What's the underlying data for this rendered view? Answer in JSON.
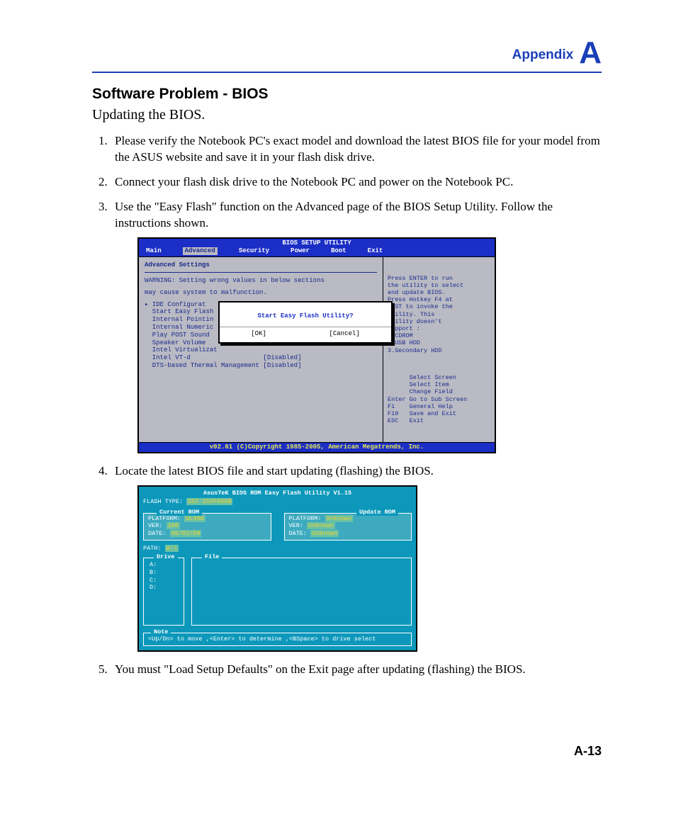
{
  "header": {
    "appendix": "Appendix",
    "letter": "A"
  },
  "title": "Software Problem - BIOS",
  "subtitle": "Updating the BIOS.",
  "steps": {
    "s1": "Please verify the Notebook PC's exact model and download the latest BIOS file for your model from the ASUS website and save it in your flash disk drive.",
    "s2": "Connect your flash disk drive to the Notebook PC and power on the Notebook PC.",
    "s3": "Use the \"Easy Flash\" function on the Advanced page of the BIOS Setup Utility. Follow the instructions shown.",
    "s4": "Locate the latest BIOS file and start updating (flashing) the BIOS.",
    "s5": "You must \"Load Setup Defaults\" on the Exit page after updating (flashing) the BIOS."
  },
  "bios": {
    "title": "BIOS SETUP UTILITY",
    "menu": {
      "main": "Main",
      "advanced": "Advanced",
      "security": "Security",
      "power": "Power",
      "boot": "Boot",
      "exit": "Exit"
    },
    "section": "Advanced Settings",
    "warning1": "WARNING: Setting wrong values in below sections",
    "warning2": "         may cause system to malfunction.",
    "items_text": "▸ IDE Configurat\n  Start Easy Flash\n  Internal Pointin\n  Internal Numeric\n  Play POST Sound\n  Speaker Volume\n  Intel Virtualizat\n  Intel VT-d                   [Disabled]\n  DTS-based Thermal Management [Disabled]",
    "help": "Press ENTER to run\nthe utility to select\nand update BIOS.\nPress Hotkey F4 at\nPOST to invoke the\nutility. This\nutility doesn't\nsupport :\n1.CDROM\n2.USB HDD\n3.Secondary HDD",
    "keys": "      Select Screen\n      Select Item\n      Change Field\nEnter Go to Sub Screen\nF1    General Help\nF10   Save and Exit\nESC   Exit",
    "footer": "v02.61 (C)Copyright 1985-2005, American Megatrends, Inc.",
    "dialog": {
      "q": "Start Easy Flash Utility?",
      "ok": "[OK]",
      "cancel": "[Cancel]"
    }
  },
  "flash": {
    "title": "AsusTeK BIOS ROM Easy Flash Utility V1.15",
    "flash_type_label": "FLASH TYPE:",
    "flash_type_value": "SST 25VF080B",
    "current": {
      "legend": "Current ROM",
      "platform_l": "PLATFORM:",
      "platform_v": "UL30A",
      "ver_l": "VER:",
      "ver_v": "100",
      "date_l": "DATE:",
      "date_v": "06/01/09"
    },
    "update": {
      "legend": "Update ROM",
      "platform_l": "PLATFORM:",
      "platform_v": "Unknown",
      "ver_l": "VER:",
      "ver_v": "Unknown",
      "date_l": "DATE:",
      "date_v": "Unknown"
    },
    "path_l": "PATH:",
    "path_v": "A:\\",
    "drive_legend": "Drive",
    "file_legend": "File",
    "drives": "A:\nB:\nC:\nD:",
    "note_legend": "Note",
    "note": "<Up/Dn> to move ,<Enter> to determine ,<BSpace> to drive select"
  },
  "page_number": "A-13"
}
